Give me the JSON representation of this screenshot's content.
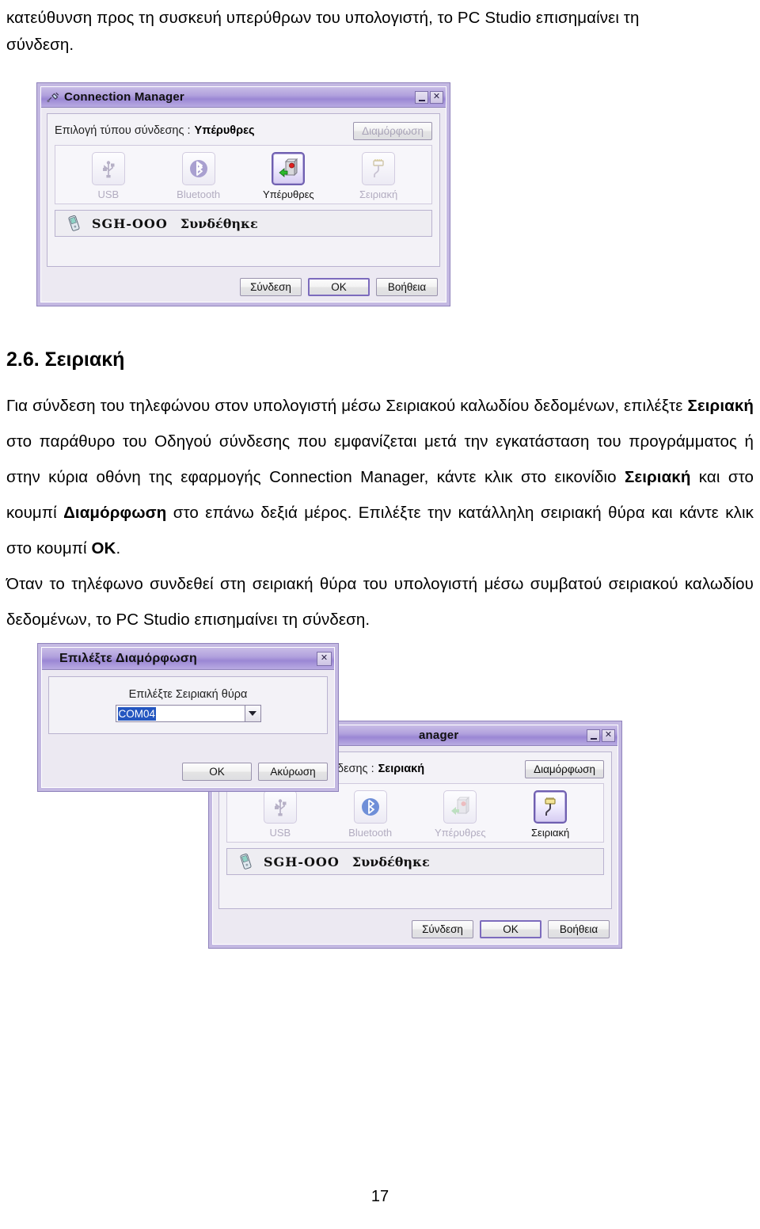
{
  "document": {
    "top_paragraph": {
      "line1": "κατεύθυνση προς τη συσκευή υπερύθρων του υπολογιστή, το PC Studio επισημαίνει τη",
      "line2": "σύνδεση."
    },
    "heading": "2.6. Σειριακή",
    "para1_part1": "Για σύνδεση του τηλεφώνου στον υπολογιστή μέσω Σειριακού καλωδίου δεδομένων, επιλέξτε ",
    "para1_bold1": "Σειριακή",
    "para1_part2": " στο παράθυρο του Οδηγού σύνδεσης που εμφανίζεται μετά την εγκατάσταση του προγράμματος ή στην κύρια οθόνη της εφαρμογής Connection Manager, κάντε κλικ στο εικονίδιο ",
    "para1_bold2": "Σειριακή",
    "para1_part3": " και στο κουμπί ",
    "para1_bold3": "Διαμόρφωση",
    "para1_part4": " στο επάνω δεξιά μέρος. Επιλέξτε την κατάλληλη σειριακή θύρα και κάντε κλικ στο κουμπί ",
    "para1_bold4": "OK",
    "para1_part5": ".",
    "para2": "Όταν το τηλέφωνο συνδεθεί στη σειριακή θύρα του υπολογιστή μέσω συμβατού σειριακού καλωδίου δεδομένων, το PC Studio επισημαίνει τη σύνδεση.",
    "page_number": "17"
  },
  "connection_manager_top": {
    "title": "Connection Manager",
    "titlebar_icon": "connection-plug-icon",
    "minimize_label": "_",
    "close_label": "✕",
    "type_label": "Επιλογή τύπου σύνδεσης :",
    "type_value": "Υπέρυθρες",
    "configure_button": "Διαμόρφωση",
    "configure_enabled": false,
    "icons": [
      {
        "label": "USB",
        "name": "usb-icon",
        "selected": false
      },
      {
        "label": "Bluetooth",
        "name": "bluetooth-icon",
        "selected": false
      },
      {
        "label": "Υπέρυθρες",
        "name": "infrared-icon",
        "selected": true
      },
      {
        "label": "Σειριακή",
        "name": "serial-port-icon",
        "selected": false
      }
    ],
    "device_name": "SGH-OOO",
    "device_status": "Συνδέθηκε",
    "buttons": {
      "connect": "Σύνδεση",
      "ok": "OK",
      "help": "Βοήθεια"
    }
  },
  "select_config_dialog": {
    "title": "Επιλέξτε Διαμόρφωση",
    "close_label": "✕",
    "field_label": "Επιλέξτε Σειριακή θύρα",
    "combo_value": "COM04",
    "buttons": {
      "ok": "OK",
      "cancel": "Ακύρωση"
    }
  },
  "connection_manager_bottom": {
    "title": "anager",
    "minimize_label": "_",
    "close_label": "✕",
    "type_label": "δεσης :",
    "type_value": "Σειριακή",
    "configure_button": "Διαμόρφωση",
    "configure_enabled": true,
    "icons": [
      {
        "label": "USB",
        "name": "usb-icon",
        "selected": false
      },
      {
        "label": "Bluetooth",
        "name": "bluetooth-icon",
        "selected": false
      },
      {
        "label": "Υπέρυθρες",
        "name": "infrared-icon",
        "selected": false
      },
      {
        "label": "Σειριακή",
        "name": "serial-port-icon",
        "selected": true
      }
    ],
    "device_name": "SGH-OOO",
    "device_status": "Συνδέθηκε",
    "buttons": {
      "connect": "Σύνδεση",
      "ok": "OK",
      "help": "Βοήθεια"
    }
  },
  "colors": {
    "window_frame": "#c4b9e2",
    "titlebar_purple": "#9b87d4",
    "selection_blue": "#2456c0",
    "focus_border": "#7c6bbd"
  }
}
